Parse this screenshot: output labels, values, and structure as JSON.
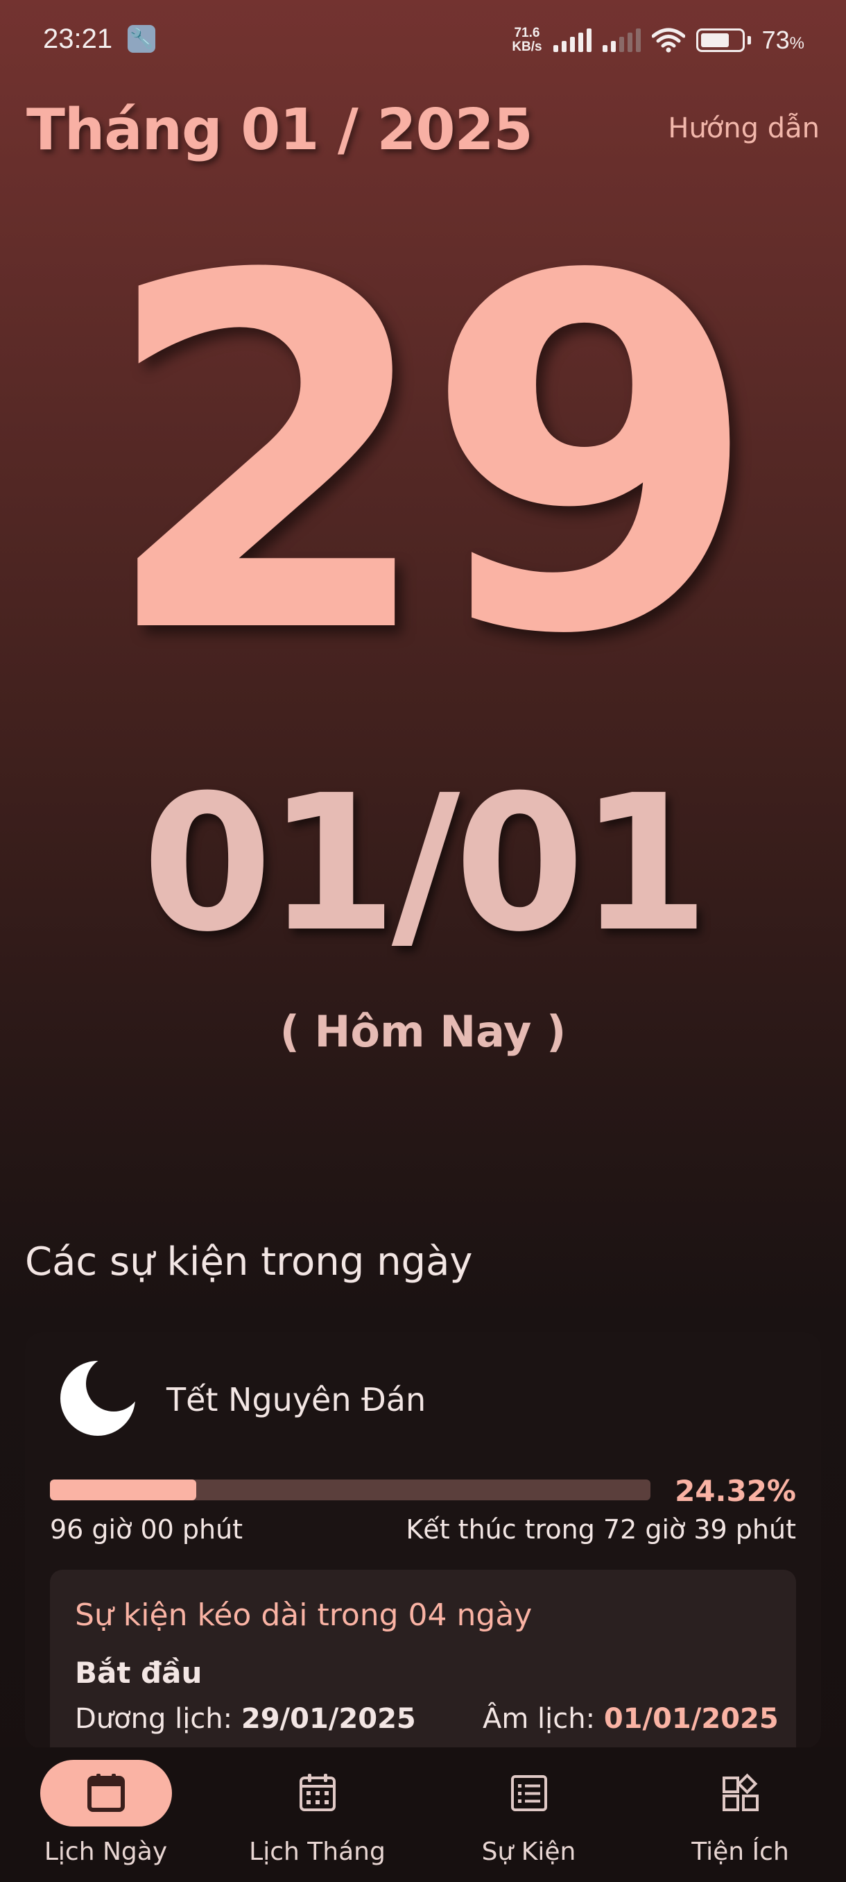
{
  "status_bar": {
    "time": "23:21",
    "net_speed_value": "71.6",
    "net_speed_unit": "KB/s",
    "battery_percent": "73",
    "battery_unit": "%",
    "icons": [
      "tool-icon",
      "signal-icon",
      "wifi-icon",
      "battery-icon"
    ]
  },
  "header": {
    "month_title": "Tháng 01 / 2025",
    "guide_label": "Hướng dẫn"
  },
  "date": {
    "day": "29",
    "lunar": "01/01",
    "today_label": "( Hôm Nay )"
  },
  "events": {
    "heading": "Các sự kiện trong ngày",
    "items": [
      {
        "icon": "moon-icon",
        "name": "Tết Nguyên Đán",
        "progress": 24.32,
        "progress_label": "24.32%",
        "duration_label": "96 giờ 00 phút",
        "remaining_label": "Kết thúc trong 72 giờ 39 phút",
        "detail_title": "Sự kiện kéo dài trong 04 ngày",
        "start_label": "Bắt đầu",
        "solar_label": "Dương lịch:",
        "solar_value": "29/01/2025",
        "lunar_label": "Âm lịch:",
        "lunar_value": "01/01/2025"
      }
    ]
  },
  "colors": {
    "accent": "#fab3a4",
    "lunar_text": "#e6bbb4",
    "track": "#5b3f3c",
    "card": "#1b1313"
  },
  "nav": {
    "items": [
      {
        "label": "Lịch Ngày",
        "icon": "calendar-day-icon",
        "active": true
      },
      {
        "label": "Lịch Tháng",
        "icon": "calendar-month-icon",
        "active": false
      },
      {
        "label": "Sự Kiện",
        "icon": "event-list-icon",
        "active": false
      },
      {
        "label": "Tiện Ích",
        "icon": "widgets-icon",
        "active": false
      }
    ]
  }
}
